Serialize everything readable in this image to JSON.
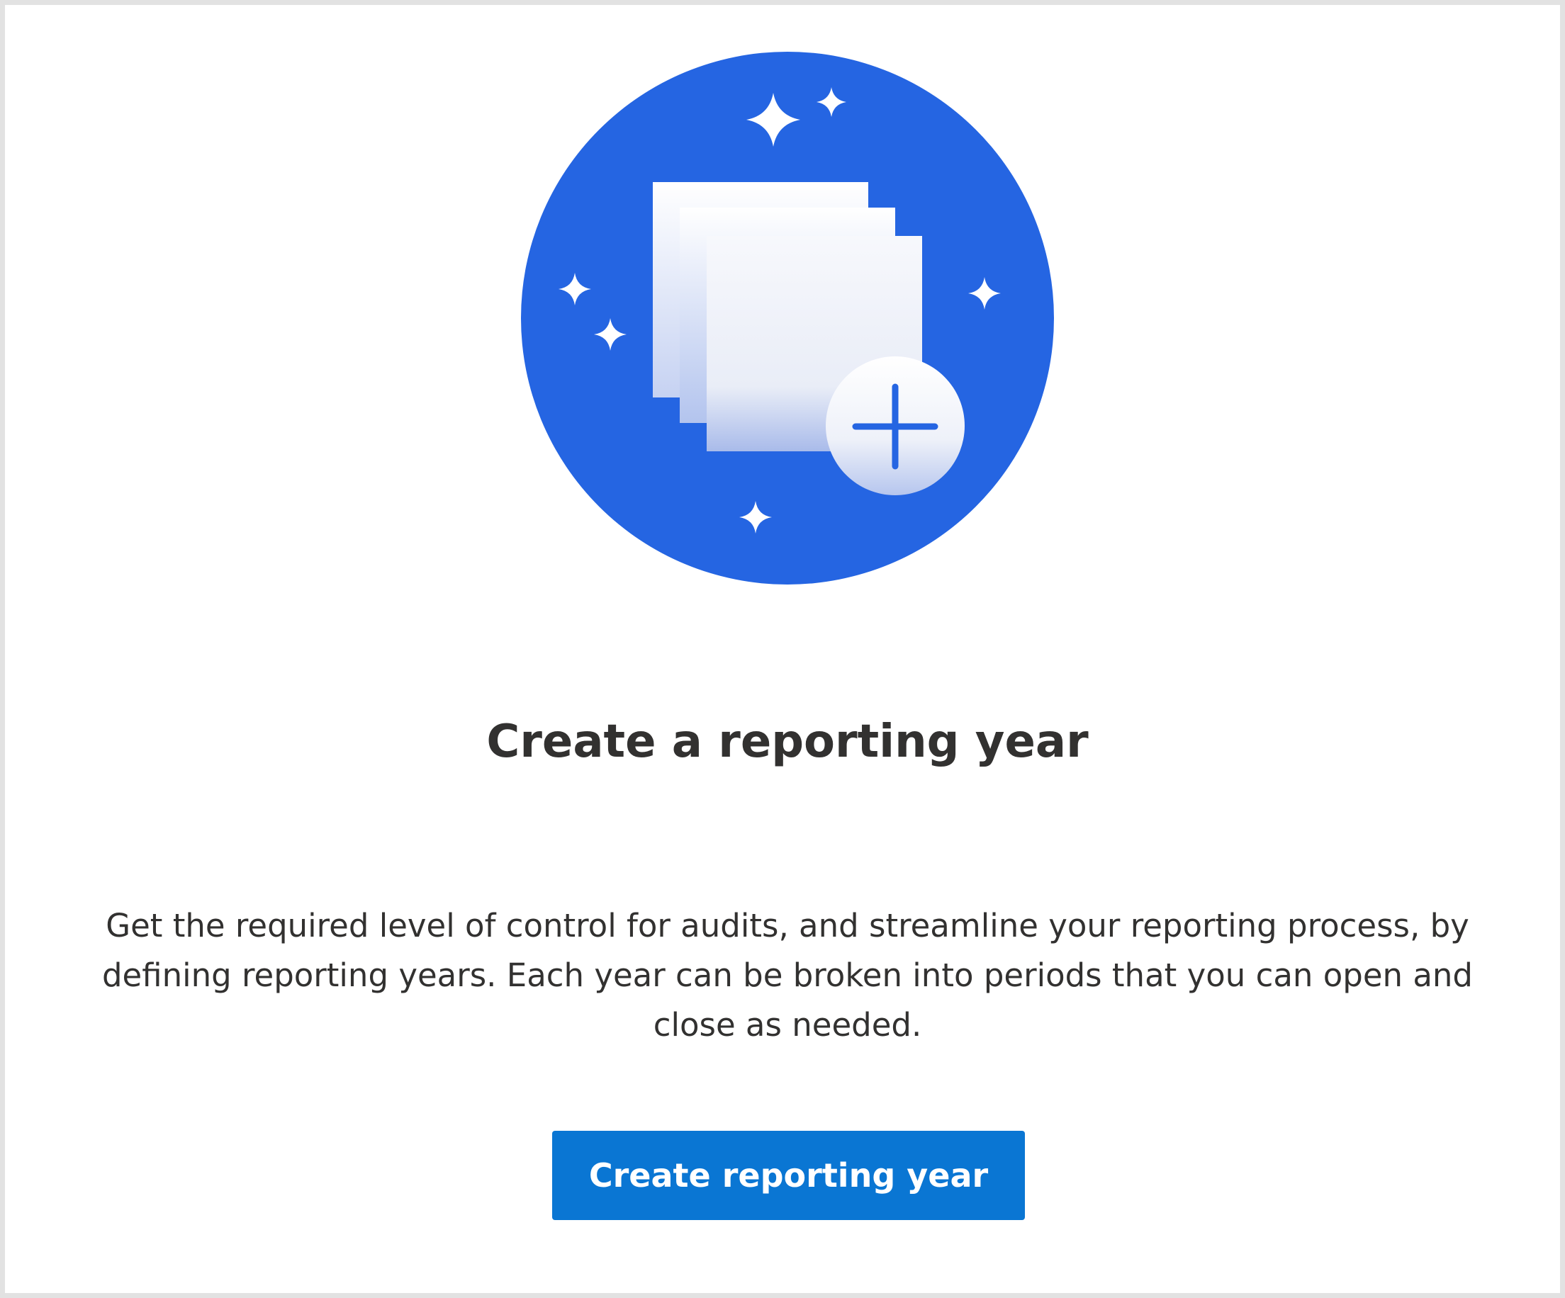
{
  "empty_state": {
    "illustration_icon": "documents-plus-icon",
    "accent_color": "#2565e2",
    "title": "Create a reporting year",
    "description": "Get the required level of control for audits, and streamline your reporting process, by defining reporting years. Each year can be broken into periods that you can open and close as needed.",
    "button_label": "Create reporting year",
    "button_color": "#0a76d3"
  }
}
